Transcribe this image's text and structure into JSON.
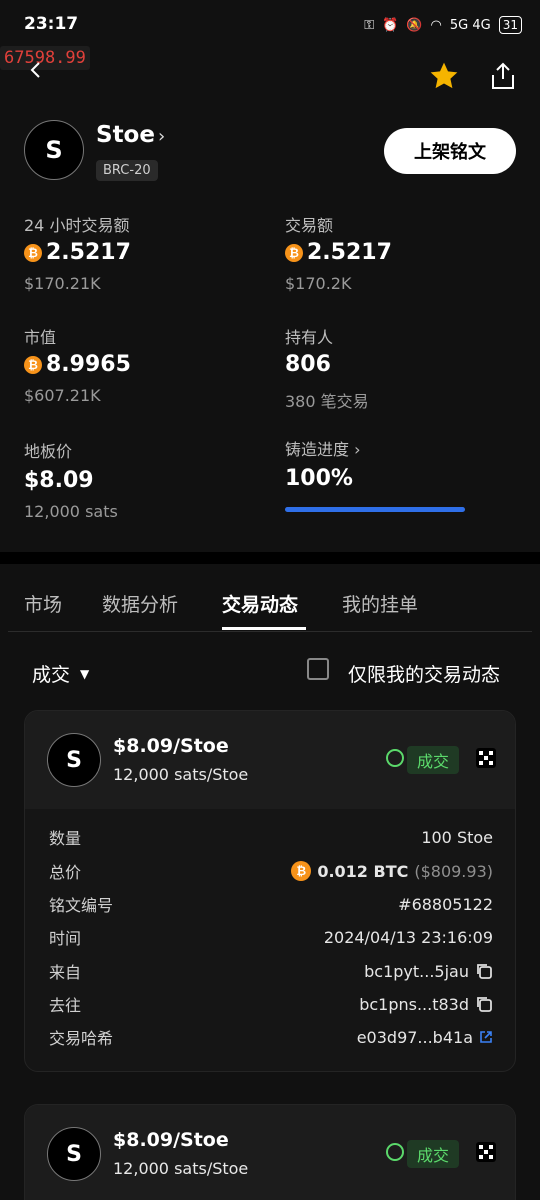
{
  "status": {
    "time": "23:17",
    "network": "5G 4G",
    "battery": "31"
  },
  "price_overlay": "67598.99",
  "token": {
    "avatar_letter": "S",
    "name": "Stoe",
    "standard": "BRC-20",
    "list_button": "上架铭文"
  },
  "stats": {
    "vol24h": {
      "label": "24 小时交易额",
      "value": "2.5217",
      "usd": "$170.21K"
    },
    "volume": {
      "label": "交易额",
      "value": "2.5217",
      "usd": "$170.2K"
    },
    "market_cap": {
      "label": "市值",
      "value": "8.9965",
      "usd": "$607.21K"
    },
    "holders": {
      "label": "持有人",
      "value": "806",
      "sub": "380 笔交易"
    },
    "floor": {
      "label": "地板价",
      "value": "$8.09",
      "sub": "12,000 sats"
    },
    "mint": {
      "label": "铸造进度",
      "value": "100%",
      "progress": 1.0
    }
  },
  "tabs": [
    "市场",
    "数据分析",
    "交易动态",
    "我的挂单"
  ],
  "active_tab": "交易动态",
  "filter": {
    "selected": "成交",
    "checkbox_label": "仅限我的交易动态"
  },
  "colors": {
    "accent_blue": "#2f6fe8",
    "btc_orange": "#f7931a",
    "success_green": "#5bd96b"
  },
  "trades": [
    {
      "price": "$8.09/Stoe",
      "sats": "12,000 sats/Stoe",
      "status": "成交",
      "details": {
        "quantity": {
          "label": "数量",
          "value": "100 Stoe"
        },
        "total": {
          "label": "总价",
          "btc": "0.012 BTC",
          "usd": "($809.93)"
        },
        "inscription": {
          "label": "铭文编号",
          "value": "#68805122"
        },
        "time": {
          "label": "时间",
          "value": "2024/04/13 23:16:09"
        },
        "from": {
          "label": "来自",
          "value": "bc1pyt...5jau"
        },
        "to": {
          "label": "去往",
          "value": "bc1pns...t83d"
        },
        "hash": {
          "label": "交易哈希",
          "value": "e03d97...b41a"
        }
      }
    },
    {
      "price": "$8.09/Stoe",
      "sats": "12,000 sats/Stoe",
      "status": "成交"
    }
  ]
}
